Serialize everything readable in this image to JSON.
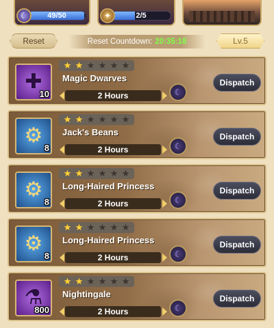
{
  "resources": [
    {
      "value": "49/50",
      "fill": 0.98,
      "icon": "moon-orb-icon"
    },
    {
      "value": "2/5",
      "fill": 0.4,
      "icon": "gold-orb-icon"
    }
  ],
  "controls": {
    "reset_label": "Reset",
    "countdown_label": "Reset Countdown:",
    "countdown_time": "20:35:18",
    "level_label": "Lv.5"
  },
  "missions": [
    {
      "name": "Magic Dwarves",
      "stars": 2,
      "max_stars": 6,
      "duration": "2 Hours",
      "reward_count": "10",
      "reward_type": "puzzle-piece",
      "reward_color": "purple",
      "dispatch_label": "Dispatch"
    },
    {
      "name": "Jack's Beans",
      "stars": 2,
      "max_stars": 6,
      "duration": "2 Hours",
      "reward_count": "8",
      "reward_type": "gear",
      "reward_color": "blue",
      "dispatch_label": "Dispatch"
    },
    {
      "name": "Long-Haired Princess",
      "stars": 2,
      "max_stars": 6,
      "duration": "2 Hours",
      "reward_count": "8",
      "reward_type": "gear",
      "reward_color": "blue",
      "dispatch_label": "Dispatch"
    },
    {
      "name": "Long-Haired Princess",
      "stars": 2,
      "max_stars": 6,
      "duration": "2 Hours",
      "reward_count": "8",
      "reward_type": "gear",
      "reward_color": "blue",
      "dispatch_label": "Dispatch"
    },
    {
      "name": "Nightingale",
      "stars": 2,
      "max_stars": 6,
      "duration": "2 Hours",
      "reward_count": "800",
      "reward_type": "potion",
      "reward_color": "purple",
      "dispatch_label": "Dispatch"
    }
  ]
}
